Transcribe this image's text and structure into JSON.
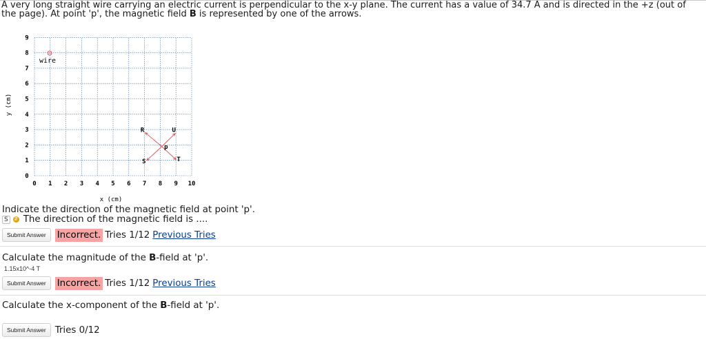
{
  "problem": {
    "before_B": "A very long straight wire carrying an electric current is perpendicular to the x-y plane. The current has a value of 34.7 A and is directed in the +z (out of the page). At point 'p', the magnetic field ",
    "B": "B",
    "after_B": " is represented by one of the arrows."
  },
  "plot": {
    "x_ticks": [
      "0",
      "1",
      "2",
      "3",
      "4",
      "5",
      "6",
      "7",
      "8",
      "9",
      "10"
    ],
    "y_ticks": [
      "0",
      "1",
      "2",
      "3",
      "4",
      "5",
      "6",
      "7",
      "8",
      "9"
    ],
    "xlabel": "x (cm)",
    "ylabel": "y (cm)",
    "wire_label": "wire",
    "point_labels": {
      "R": "R",
      "U": "U",
      "p": "p",
      "S": "S",
      "T": "T"
    }
  },
  "q1": {
    "text": "Indicate the direction of the magnetic field at point 'p'.",
    "select_value": "S",
    "select_icon": "chevron-up-down-icon",
    "label": "The direction of the magnetic field is ....",
    "submit": "Submit Answer",
    "status": "Incorrect.",
    "tries": "Tries 1/12",
    "prev": "Previous Tries"
  },
  "q2": {
    "prefix": "Calculate the magnitude of the ",
    "B": "B",
    "suffix": "-field at 'p'.",
    "answer": "1.15x10^-4 T",
    "submit": "Submit Answer",
    "status": "Incorrect.",
    "tries": "Tries 1/12",
    "prev": "Previous Tries"
  },
  "q3": {
    "prefix": "Calculate the x-component of the ",
    "B": "B",
    "suffix": "-field at 'p'.",
    "submit": "Submit Answer",
    "tries": "Tries 0/12"
  },
  "colors": {
    "incorrect_bg": "#f7a3a3",
    "link": "#0b3d91",
    "arrow": "#e05050",
    "grid": "#3a6ea5"
  }
}
